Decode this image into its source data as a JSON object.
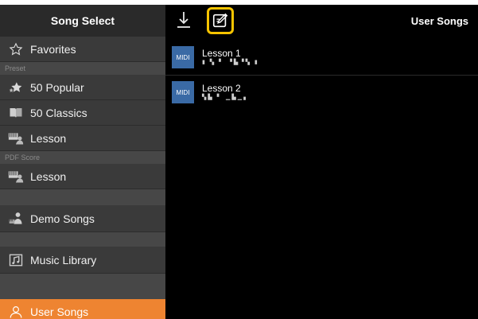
{
  "sidebar": {
    "title": "Song Select",
    "favorites": "Favorites",
    "preset_label": "Preset",
    "preset_items": [
      "50 Popular",
      "50 Classics",
      "Lesson"
    ],
    "pdf_label": "PDF Score",
    "pdf_items": [
      "Lesson"
    ],
    "demo_songs": "Demo Songs",
    "music_library": "Music Library",
    "user_songs": "User Songs"
  },
  "main": {
    "title": "User Songs",
    "songs": [
      {
        "badge": "MIDI",
        "name": "Lesson 1",
        "subtitle": "▮ ▚ ▘ ▝▙▝▚ ▮"
      },
      {
        "badge": "MIDI",
        "name": "Lesson 2",
        "subtitle": "▚▙ ▘ ▁▙▁▖"
      }
    ]
  },
  "colors": {
    "accent": "#ee8431",
    "highlight": "#f6c400",
    "midi_badge": "#3a6aa5"
  }
}
